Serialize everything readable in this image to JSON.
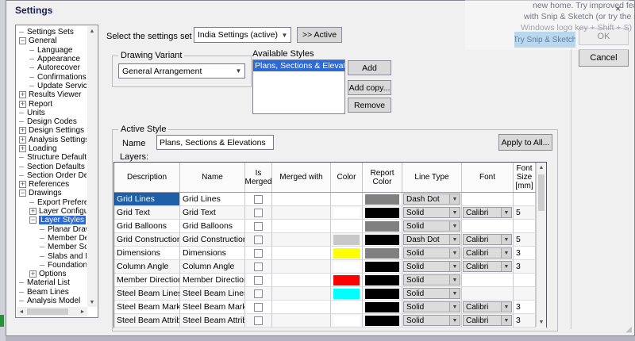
{
  "window": {
    "title": "Settings"
  },
  "settings_set": {
    "label": "Select the settings set to edit:",
    "value": "India Settings (active)",
    "active_button": ">> Active"
  },
  "drawing_variant": {
    "label": "Drawing Variant",
    "value": "General Arrangement"
  },
  "available_styles": {
    "label": "Available Styles",
    "items": [
      "Plans, Sections & Elevations"
    ],
    "selected_index": 0,
    "add_button": "Add",
    "add_copy_button": "Add copy...",
    "remove_button": "Remove"
  },
  "active_style": {
    "label": "Active Style",
    "name_label": "Name",
    "name_value": "Plans, Sections & Elevations",
    "apply_button": "Apply to All...",
    "layers_label": "Layers:"
  },
  "layers_table": {
    "columns": [
      "Description",
      "Name",
      "Is\nMerged",
      "Merged with",
      "Color",
      "Report\nColor",
      "Line Type",
      "Font",
      "Font\nSize\n[mm]"
    ],
    "rows": [
      {
        "description": "Grid Lines",
        "name": "Grid Lines",
        "is_merged": false,
        "merged_with": "",
        "color": "#ffffff",
        "report_color": "#808080",
        "line_type": "Dash Dot",
        "font": "",
        "font_size": "",
        "selected": true
      },
      {
        "description": "Grid Text",
        "name": "Grid Text",
        "is_merged": false,
        "merged_with": "",
        "color": "#ffffff",
        "report_color": "#000000",
        "line_type": "Solid",
        "font": "Calibri",
        "font_size": "5",
        "selected": false
      },
      {
        "description": "Grid Balloons",
        "name": "Grid Balloons",
        "is_merged": false,
        "merged_with": "",
        "color": "#ffffff",
        "report_color": "#808080",
        "line_type": "Solid",
        "font": "",
        "font_size": "",
        "selected": false
      },
      {
        "description": "Grid Construction Li...",
        "name": "Grid Construction Li...",
        "is_merged": false,
        "merged_with": "",
        "color": "#c8c8c8",
        "report_color": "#000000",
        "line_type": "Dash Dot",
        "font": "Calibri",
        "font_size": "5",
        "selected": false
      },
      {
        "description": "Dimensions",
        "name": "Dimensions",
        "is_merged": false,
        "merged_with": "",
        "color": "#ffff00",
        "report_color": "#808080",
        "line_type": "Solid",
        "font": "Calibri",
        "font_size": "3",
        "selected": false
      },
      {
        "description": "Column Angle",
        "name": "Column Angle",
        "is_merged": false,
        "merged_with": "",
        "color": "#ffffff",
        "report_color": "#000000",
        "line_type": "Solid",
        "font": "Calibri",
        "font_size": "3",
        "selected": false
      },
      {
        "description": "Member Direction",
        "name": "Member Direction",
        "is_merged": false,
        "merged_with": "",
        "color": "#ff0000",
        "report_color": "#000000",
        "line_type": "Solid",
        "font": "",
        "font_size": "",
        "selected": false
      },
      {
        "description": "Steel Beam Lines",
        "name": "Steel Beam Lines",
        "is_merged": false,
        "merged_with": "",
        "color": "#00ffff",
        "report_color": "#000000",
        "line_type": "Solid",
        "font": "",
        "font_size": "",
        "selected": false
      },
      {
        "description": "Steel Beam Mark",
        "name": "Steel Beam Mark",
        "is_merged": false,
        "merged_with": "",
        "color": "#ffffff",
        "report_color": "#000000",
        "line_type": "Solid",
        "font": "Calibri",
        "font_size": "3",
        "selected": false
      },
      {
        "description": "Steel Beam Attributes",
        "name": "Steel Beam Attributes",
        "is_merged": false,
        "merged_with": "",
        "color": "#ffffff",
        "report_color": "#000000",
        "line_type": "Solid",
        "font": "Calibri",
        "font_size": "3",
        "selected": false
      }
    ]
  },
  "tree": {
    "items": [
      {
        "label": "Settings Sets",
        "level": 0,
        "glyph": "leaf",
        "selected": false
      },
      {
        "label": "General",
        "level": 0,
        "glyph": "minus",
        "selected": false
      },
      {
        "label": "Language",
        "level": 1,
        "glyph": "leaf",
        "selected": false
      },
      {
        "label": "Appearance",
        "level": 1,
        "glyph": "leaf",
        "selected": false
      },
      {
        "label": "Autorecover",
        "level": 1,
        "glyph": "leaf",
        "selected": false
      },
      {
        "label": "Confirmations",
        "level": 1,
        "glyph": "leaf",
        "selected": false
      },
      {
        "label": "Update Service",
        "level": 1,
        "glyph": "leaf",
        "selected": false
      },
      {
        "label": "Results Viewer",
        "level": 0,
        "glyph": "plus",
        "selected": false
      },
      {
        "label": "Report",
        "level": 0,
        "glyph": "plus",
        "selected": false
      },
      {
        "label": "Units",
        "level": 0,
        "glyph": "leaf",
        "selected": false
      },
      {
        "label": "Design Codes",
        "level": 0,
        "glyph": "leaf",
        "selected": false
      },
      {
        "label": "Design Settings",
        "level": 0,
        "glyph": "plus",
        "selected": false
      },
      {
        "label": "Analysis Settings",
        "level": 0,
        "glyph": "plus",
        "selected": false
      },
      {
        "label": "Loading",
        "level": 0,
        "glyph": "plus",
        "selected": false
      },
      {
        "label": "Structure Defaults",
        "level": 0,
        "glyph": "leaf",
        "selected": false
      },
      {
        "label": "Section Defaults",
        "level": 0,
        "glyph": "leaf",
        "selected": false
      },
      {
        "label": "Section Order Defau",
        "level": 0,
        "glyph": "leaf",
        "selected": false
      },
      {
        "label": "References",
        "level": 0,
        "glyph": "plus",
        "selected": false
      },
      {
        "label": "Drawings",
        "level": 0,
        "glyph": "minus",
        "selected": false
      },
      {
        "label": "Export Preferenc",
        "level": 1,
        "glyph": "leaf",
        "selected": false
      },
      {
        "label": "Layer Configurat",
        "level": 1,
        "glyph": "plus",
        "selected": false
      },
      {
        "label": "Layer Styles",
        "level": 1,
        "glyph": "minus",
        "selected": true
      },
      {
        "label": "Planar Drawi",
        "level": 2,
        "glyph": "leaf",
        "selected": false
      },
      {
        "label": "Member Det",
        "level": 2,
        "glyph": "leaf",
        "selected": false
      },
      {
        "label": "Member Sch",
        "level": 2,
        "glyph": "leaf",
        "selected": false
      },
      {
        "label": "Slabs and M",
        "level": 2,
        "glyph": "leaf",
        "selected": false
      },
      {
        "label": "Foundations",
        "level": 2,
        "glyph": "leaf",
        "selected": false
      },
      {
        "label": "Options",
        "level": 1,
        "glyph": "plus",
        "selected": false
      },
      {
        "label": "Material List",
        "level": 0,
        "glyph": "leaf",
        "selected": false
      },
      {
        "label": "Beam Lines",
        "level": 0,
        "glyph": "leaf",
        "selected": false
      },
      {
        "label": "Analysis Model",
        "level": 0,
        "glyph": "leaf",
        "selected": false
      }
    ]
  },
  "dialog_buttons": {
    "ok": "OK",
    "cancel": "Cancel"
  },
  "notification": {
    "line1": "new home. Try improved features an",
    "line2": "with Snip & Sketch (or try the shortc",
    "line3": "Windows logo key + Shift + S)",
    "action_button": "Try Snip & Sketch",
    "close_icon": "×"
  },
  "colors": {
    "selection_blue": "#2e6ad1",
    "table_selection_blue": "#1e5fa8",
    "dialog_background": "#f0f0f0",
    "combo_gray": "#dcdcdc"
  }
}
